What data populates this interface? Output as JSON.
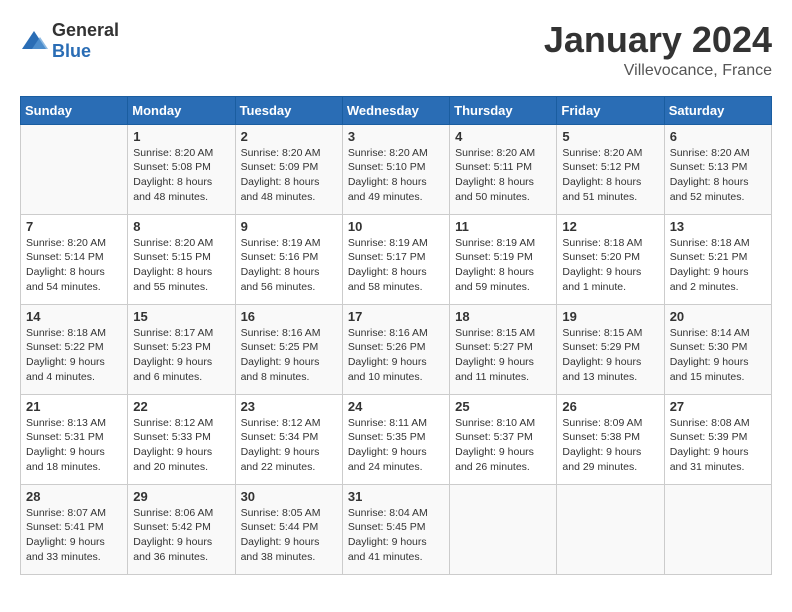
{
  "header": {
    "logo": {
      "general": "General",
      "blue": "Blue"
    },
    "title": "January 2024",
    "location": "Villevocance, France"
  },
  "calendar": {
    "days_of_week": [
      "Sunday",
      "Monday",
      "Tuesday",
      "Wednesday",
      "Thursday",
      "Friday",
      "Saturday"
    ],
    "weeks": [
      [
        {
          "day": "",
          "empty": true
        },
        {
          "day": "1",
          "sunrise": "Sunrise: 8:20 AM",
          "sunset": "Sunset: 5:08 PM",
          "daylight": "Daylight: 8 hours and 48 minutes."
        },
        {
          "day": "2",
          "sunrise": "Sunrise: 8:20 AM",
          "sunset": "Sunset: 5:09 PM",
          "daylight": "Daylight: 8 hours and 48 minutes."
        },
        {
          "day": "3",
          "sunrise": "Sunrise: 8:20 AM",
          "sunset": "Sunset: 5:10 PM",
          "daylight": "Daylight: 8 hours and 49 minutes."
        },
        {
          "day": "4",
          "sunrise": "Sunrise: 8:20 AM",
          "sunset": "Sunset: 5:11 PM",
          "daylight": "Daylight: 8 hours and 50 minutes."
        },
        {
          "day": "5",
          "sunrise": "Sunrise: 8:20 AM",
          "sunset": "Sunset: 5:12 PM",
          "daylight": "Daylight: 8 hours and 51 minutes."
        },
        {
          "day": "6",
          "sunrise": "Sunrise: 8:20 AM",
          "sunset": "Sunset: 5:13 PM",
          "daylight": "Daylight: 8 hours and 52 minutes."
        }
      ],
      [
        {
          "day": "7",
          "sunrise": "Sunrise: 8:20 AM",
          "sunset": "Sunset: 5:14 PM",
          "daylight": "Daylight: 8 hours and 54 minutes."
        },
        {
          "day": "8",
          "sunrise": "Sunrise: 8:20 AM",
          "sunset": "Sunset: 5:15 PM",
          "daylight": "Daylight: 8 hours and 55 minutes."
        },
        {
          "day": "9",
          "sunrise": "Sunrise: 8:19 AM",
          "sunset": "Sunset: 5:16 PM",
          "daylight": "Daylight: 8 hours and 56 minutes."
        },
        {
          "day": "10",
          "sunrise": "Sunrise: 8:19 AM",
          "sunset": "Sunset: 5:17 PM",
          "daylight": "Daylight: 8 hours and 58 minutes."
        },
        {
          "day": "11",
          "sunrise": "Sunrise: 8:19 AM",
          "sunset": "Sunset: 5:19 PM",
          "daylight": "Daylight: 8 hours and 59 minutes."
        },
        {
          "day": "12",
          "sunrise": "Sunrise: 8:18 AM",
          "sunset": "Sunset: 5:20 PM",
          "daylight": "Daylight: 9 hours and 1 minute."
        },
        {
          "day": "13",
          "sunrise": "Sunrise: 8:18 AM",
          "sunset": "Sunset: 5:21 PM",
          "daylight": "Daylight: 9 hours and 2 minutes."
        }
      ],
      [
        {
          "day": "14",
          "sunrise": "Sunrise: 8:18 AM",
          "sunset": "Sunset: 5:22 PM",
          "daylight": "Daylight: 9 hours and 4 minutes."
        },
        {
          "day": "15",
          "sunrise": "Sunrise: 8:17 AM",
          "sunset": "Sunset: 5:23 PM",
          "daylight": "Daylight: 9 hours and 6 minutes."
        },
        {
          "day": "16",
          "sunrise": "Sunrise: 8:16 AM",
          "sunset": "Sunset: 5:25 PM",
          "daylight": "Daylight: 9 hours and 8 minutes."
        },
        {
          "day": "17",
          "sunrise": "Sunrise: 8:16 AM",
          "sunset": "Sunset: 5:26 PM",
          "daylight": "Daylight: 9 hours and 10 minutes."
        },
        {
          "day": "18",
          "sunrise": "Sunrise: 8:15 AM",
          "sunset": "Sunset: 5:27 PM",
          "daylight": "Daylight: 9 hours and 11 minutes."
        },
        {
          "day": "19",
          "sunrise": "Sunrise: 8:15 AM",
          "sunset": "Sunset: 5:29 PM",
          "daylight": "Daylight: 9 hours and 13 minutes."
        },
        {
          "day": "20",
          "sunrise": "Sunrise: 8:14 AM",
          "sunset": "Sunset: 5:30 PM",
          "daylight": "Daylight: 9 hours and 15 minutes."
        }
      ],
      [
        {
          "day": "21",
          "sunrise": "Sunrise: 8:13 AM",
          "sunset": "Sunset: 5:31 PM",
          "daylight": "Daylight: 9 hours and 18 minutes."
        },
        {
          "day": "22",
          "sunrise": "Sunrise: 8:12 AM",
          "sunset": "Sunset: 5:33 PM",
          "daylight": "Daylight: 9 hours and 20 minutes."
        },
        {
          "day": "23",
          "sunrise": "Sunrise: 8:12 AM",
          "sunset": "Sunset: 5:34 PM",
          "daylight": "Daylight: 9 hours and 22 minutes."
        },
        {
          "day": "24",
          "sunrise": "Sunrise: 8:11 AM",
          "sunset": "Sunset: 5:35 PM",
          "daylight": "Daylight: 9 hours and 24 minutes."
        },
        {
          "day": "25",
          "sunrise": "Sunrise: 8:10 AM",
          "sunset": "Sunset: 5:37 PM",
          "daylight": "Daylight: 9 hours and 26 minutes."
        },
        {
          "day": "26",
          "sunrise": "Sunrise: 8:09 AM",
          "sunset": "Sunset: 5:38 PM",
          "daylight": "Daylight: 9 hours and 29 minutes."
        },
        {
          "day": "27",
          "sunrise": "Sunrise: 8:08 AM",
          "sunset": "Sunset: 5:39 PM",
          "daylight": "Daylight: 9 hours and 31 minutes."
        }
      ],
      [
        {
          "day": "28",
          "sunrise": "Sunrise: 8:07 AM",
          "sunset": "Sunset: 5:41 PM",
          "daylight": "Daylight: 9 hours and 33 minutes."
        },
        {
          "day": "29",
          "sunrise": "Sunrise: 8:06 AM",
          "sunset": "Sunset: 5:42 PM",
          "daylight": "Daylight: 9 hours and 36 minutes."
        },
        {
          "day": "30",
          "sunrise": "Sunrise: 8:05 AM",
          "sunset": "Sunset: 5:44 PM",
          "daylight": "Daylight: 9 hours and 38 minutes."
        },
        {
          "day": "31",
          "sunrise": "Sunrise: 8:04 AM",
          "sunset": "Sunset: 5:45 PM",
          "daylight": "Daylight: 9 hours and 41 minutes."
        },
        {
          "day": "",
          "empty": true
        },
        {
          "day": "",
          "empty": true
        },
        {
          "day": "",
          "empty": true
        }
      ]
    ]
  }
}
